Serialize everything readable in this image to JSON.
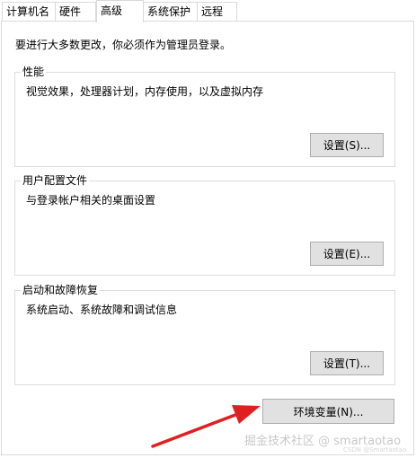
{
  "tabs": [
    {
      "label": "计算机名",
      "active": false
    },
    {
      "label": "硬件",
      "active": false
    },
    {
      "label": "高级",
      "active": true
    },
    {
      "label": "系统保护",
      "active": false
    },
    {
      "label": "远程",
      "active": false
    }
  ],
  "intro_text": "要进行大多数更改，你必须作为管理员登录。",
  "groups": {
    "performance": {
      "title": "性能",
      "description": "视觉效果，处理器计划，内存使用，以及虚拟内存",
      "button_label": "设置(S)..."
    },
    "user_profiles": {
      "title": "用户配置文件",
      "description": "与登录帐户相关的桌面设置",
      "button_label": "设置(E)..."
    },
    "startup_recovery": {
      "title": "启动和故障恢复",
      "description": "系统启动、系统故障和调试信息",
      "button_label": "设置(T)..."
    }
  },
  "env_button_label": "环境变量(N)...",
  "annotation": {
    "arrow_color": "#e02020"
  },
  "watermark": {
    "main": "掘金技术社区 @ smartaotao",
    "sub": "CSDN @Smartaotao"
  },
  "colors": {
    "button_face": "#e1e1e1",
    "button_border": "#adadad",
    "group_border": "#dcdcdc",
    "tab_border": "#d9d9d9"
  }
}
